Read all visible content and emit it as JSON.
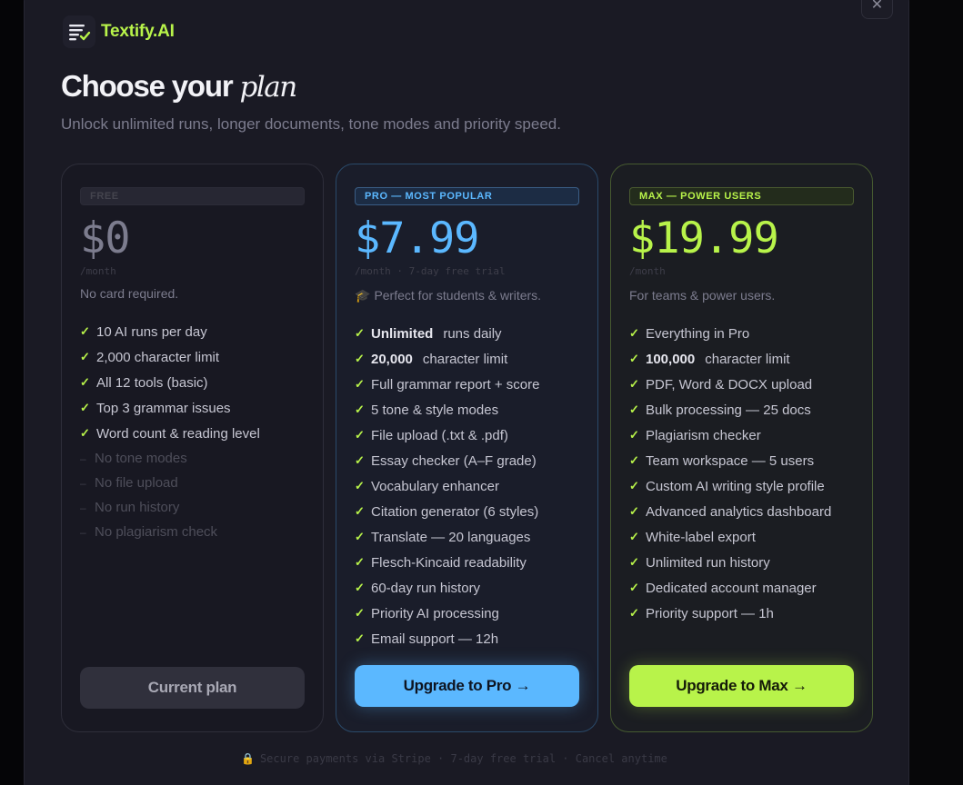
{
  "brand": {
    "name": "Textify.AI",
    "icon": "document-check-icon",
    "color": "#b8f34a"
  },
  "modal": {
    "close_label": "✕"
  },
  "header": {
    "title": "Choose your",
    "title_accent": "plan",
    "subtitle": "Unlock unlimited runs, longer documents, tone modes and priority speed."
  },
  "plans": [
    {
      "badge": "FREE",
      "price": "$0",
      "period": "/month",
      "tagline": "No card required.",
      "features": [
        {
          "text": "10 AI runs per day",
          "included": true
        },
        {
          "text": "2,000 character limit",
          "included": true
        },
        {
          "text": "All 12 tools (basic)",
          "included": true
        },
        {
          "text": "Top 3 grammar issues",
          "included": true
        },
        {
          "text": "Word count & reading level",
          "included": true
        },
        {
          "text": "No tone modes",
          "included": false
        },
        {
          "text": "No file upload",
          "included": false
        },
        {
          "text": "No run history",
          "included": false
        },
        {
          "text": "No plagiarism check",
          "included": false
        }
      ],
      "cta": "Current plan"
    },
    {
      "badge": "PRO — MOST POPULAR",
      "price": "$7.99",
      "period": "/month · 7-day free trial",
      "tagline": "Perfect for students & writers.",
      "tagline_icon": "graduation-cap-icon",
      "features": [
        {
          "bold": "Unlimited",
          "text": "runs daily",
          "included": true
        },
        {
          "bold": "20,000",
          "text": "character limit",
          "included": true
        },
        {
          "text": "Full grammar report + score",
          "included": true
        },
        {
          "text": "5 tone & style modes",
          "included": true
        },
        {
          "text": "File upload (.txt & .pdf)",
          "included": true
        },
        {
          "text": "Essay checker (A–F grade)",
          "included": true
        },
        {
          "text": "Vocabulary enhancer",
          "included": true
        },
        {
          "text": "Citation generator (6 styles)",
          "included": true
        },
        {
          "text": "Translate — 20 languages",
          "included": true
        },
        {
          "text": "Flesch-Kincaid readability",
          "included": true
        },
        {
          "text": "60-day run history",
          "included": true
        },
        {
          "text": "Priority AI processing",
          "included": true
        },
        {
          "text": "Email support — 12h",
          "included": true
        }
      ],
      "cta": "Upgrade to Pro →"
    },
    {
      "badge": "MAX — POWER USERS",
      "price": "$19.99",
      "period": "/month",
      "tagline": "For teams & power users.",
      "features": [
        {
          "text": "Everything in Pro",
          "included": true
        },
        {
          "bold": "100,000",
          "text": "character limit",
          "included": true
        },
        {
          "text": "PDF, Word & DOCX upload",
          "included": true
        },
        {
          "text": "Bulk processing — 25 docs",
          "included": true
        },
        {
          "text": "Plagiarism checker",
          "included": true
        },
        {
          "text": "Team workspace — 5 users",
          "included": true
        },
        {
          "text": "Custom AI writing style profile",
          "included": true
        },
        {
          "text": "Advanced analytics dashboard",
          "included": true
        },
        {
          "text": "White-label export",
          "included": true
        },
        {
          "text": "Unlimited run history",
          "included": true
        },
        {
          "text": "Dedicated account manager",
          "included": true
        },
        {
          "text": "Priority support — 1h",
          "included": true
        }
      ],
      "cta": "Upgrade to Max →"
    }
  ],
  "footer": {
    "icon": "lock-icon",
    "text": "Secure payments via Stripe · 7-day free trial · Cancel anytime"
  },
  "colors": {
    "background": "#1a1a24",
    "pro_accent": "#5bb8ff",
    "max_accent": "#b8f34a",
    "muted_text": "#7c7c8e"
  }
}
